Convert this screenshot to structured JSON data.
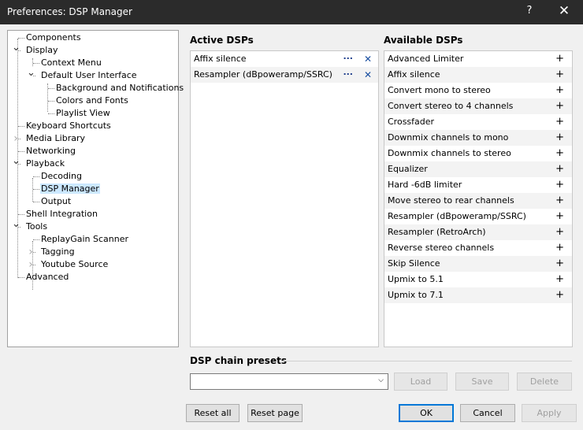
{
  "window": {
    "title": "Preferences: DSP Manager",
    "help": "?",
    "close": "✕"
  },
  "tree": [
    {
      "label": "Components",
      "level": 0
    },
    {
      "label": "Display",
      "level": 0,
      "expander": "expanded"
    },
    {
      "label": "Context Menu",
      "level": 1
    },
    {
      "label": "Default User Interface",
      "level": 1,
      "expander": "expanded"
    },
    {
      "label": "Background and Notifications",
      "level": 2
    },
    {
      "label": "Colors and Fonts",
      "level": 2
    },
    {
      "label": "Playlist View",
      "level": 2
    },
    {
      "label": "Keyboard Shortcuts",
      "level": 0
    },
    {
      "label": "Media Library",
      "level": 0,
      "expander": "collapsed"
    },
    {
      "label": "Networking",
      "level": 0
    },
    {
      "label": "Playback",
      "level": 0,
      "expander": "expanded"
    },
    {
      "label": "Decoding",
      "level": 1
    },
    {
      "label": "DSP Manager",
      "level": 1,
      "selected": true
    },
    {
      "label": "Output",
      "level": 1
    },
    {
      "label": "Shell Integration",
      "level": 0
    },
    {
      "label": "Tools",
      "level": 0,
      "expander": "expanded"
    },
    {
      "label": "ReplayGain Scanner",
      "level": 1
    },
    {
      "label": "Tagging",
      "level": 1,
      "expander": "collapsed"
    },
    {
      "label": "Youtube Source",
      "level": 1,
      "expander": "collapsed"
    },
    {
      "label": "Advanced",
      "level": 0
    }
  ],
  "active": {
    "title": "Active DSPs",
    "items": [
      "Affix silence",
      "Resampler (dBpoweramp/SSRC)"
    ],
    "configure": "...",
    "remove": "✕"
  },
  "available": {
    "title": "Available DSPs",
    "add": "+",
    "items": [
      "Advanced Limiter",
      "Affix silence",
      "Convert mono to stereo",
      "Convert stereo to 4 channels",
      "Crossfader",
      "Downmix channels to mono",
      "Downmix channels to stereo",
      "Equalizer",
      "Hard -6dB limiter",
      "Move stereo to rear channels",
      "Resampler (dBpoweramp/SSRC)",
      "Resampler (RetroArch)",
      "Reverse stereo channels",
      "Skip Silence",
      "Upmix to 5.1",
      "Upmix to 7.1"
    ]
  },
  "presets": {
    "title": "DSP chain presets",
    "value": "",
    "load": "Load",
    "save": "Save",
    "delete": "Delete"
  },
  "footer": {
    "reset_all": "Reset all",
    "reset_page": "Reset page",
    "ok": "OK",
    "cancel": "Cancel",
    "apply": "Apply"
  }
}
